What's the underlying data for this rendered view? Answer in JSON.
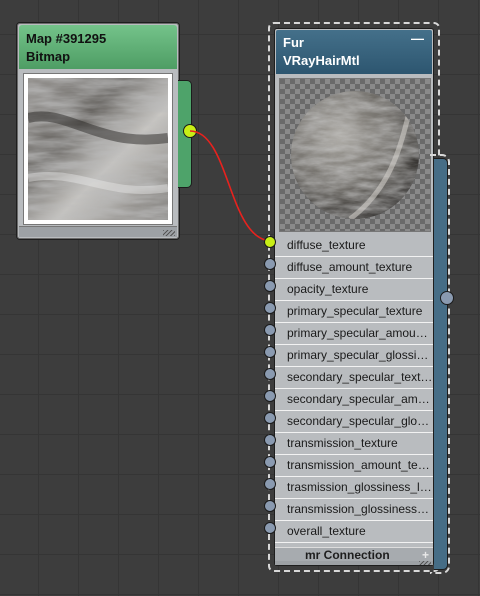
{
  "bitmap_node": {
    "title": "Map #391295",
    "subtitle": "Bitmap",
    "accent": "#5fb077"
  },
  "fur_node": {
    "title": "Fur",
    "subtitle": "VRayHairMtl",
    "minimize_glyph": "—",
    "accent": "#3a6580",
    "slots": [
      {
        "label": "diffuse_texture",
        "connected": true
      },
      {
        "label": "diffuse_amount_texture",
        "connected": false
      },
      {
        "label": "opacity_texture",
        "connected": false
      },
      {
        "label": "primary_specular_texture",
        "connected": false
      },
      {
        "label": "primary_specular_amoun…",
        "connected": false
      },
      {
        "label": "primary_specular_glossi…",
        "connected": false
      },
      {
        "label": "secondary_specular_text…",
        "connected": false
      },
      {
        "label": "secondary_specular_am…",
        "connected": false
      },
      {
        "label": "secondary_specular_glo…",
        "connected": false
      },
      {
        "label": "transmission_texture",
        "connected": false
      },
      {
        "label": "transmission_amount_te…",
        "connected": false
      },
      {
        "label": "trasmission_glossiness_l…",
        "connected": false
      },
      {
        "label": "transmission_glossiness…",
        "connected": false
      },
      {
        "label": "overall_texture",
        "connected": false
      }
    ],
    "mr_connection": {
      "label": "mr Connection",
      "expand_glyph": "+"
    }
  },
  "wire_color": "#e8221e",
  "active_socket_color": "#c8ee16"
}
